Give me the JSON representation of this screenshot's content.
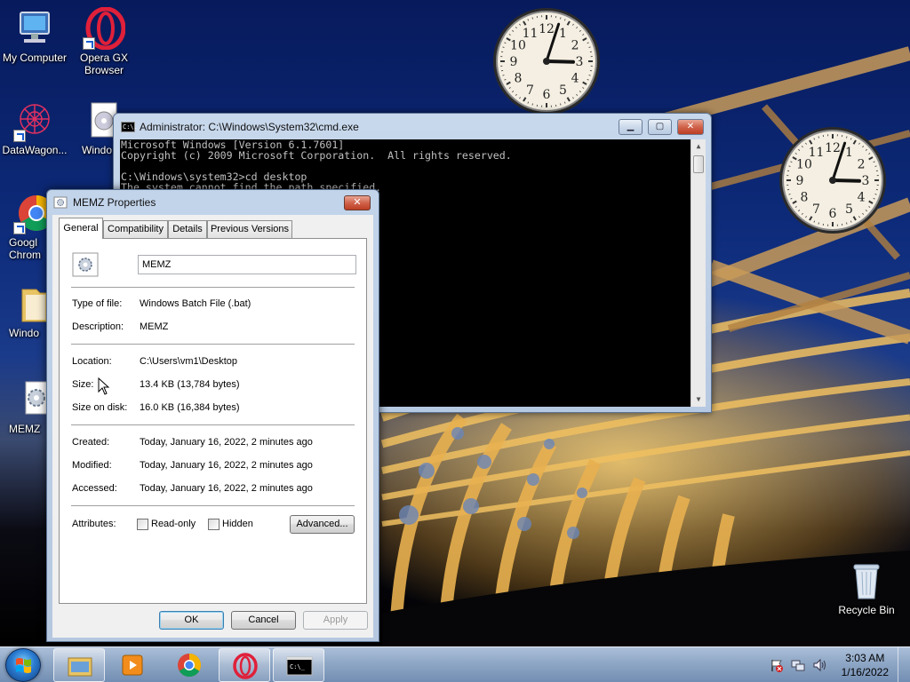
{
  "desktop": {
    "icons": [
      {
        "label": "My Computer"
      },
      {
        "label": "Opera GX Browser"
      },
      {
        "label": "DataWagon..."
      },
      {
        "label": "Windo"
      },
      {
        "label": "Googl Chrom"
      },
      {
        "label": "Windo"
      },
      {
        "label": "MEMZ"
      },
      {
        "label": "Recycle Bin"
      }
    ]
  },
  "clocks": [
    {
      "hour": 3,
      "minute": 3,
      "numerals": [
        "12",
        "1",
        "2",
        "3",
        "4",
        "5",
        "6",
        "7",
        "8",
        "9",
        "10",
        "11"
      ]
    },
    {
      "hour": 3,
      "minute": 3,
      "numerals": [
        "12",
        "1",
        "2",
        "3",
        "4",
        "5",
        "6",
        "7",
        "8",
        "9",
        "10",
        "11"
      ]
    }
  ],
  "cmd": {
    "title": "Administrator: C:\\Windows\\System32\\cmd.exe",
    "title_icon_text": "C:\\.",
    "lines": [
      "Microsoft Windows [Version 6.1.7601]",
      "Copyright (c) 2009 Microsoft Corporation.  All rights reserved.",
      "",
      "C:\\Windows\\system32>cd desktop",
      "The system cannot find the path specified."
    ],
    "minimize_label": "▁",
    "maximize_label": "▢",
    "close_label": "✕",
    "scroll_up": "▲",
    "scroll_down": "▼"
  },
  "props": {
    "title": "MEMZ Properties",
    "close_label": "✕",
    "tabs": [
      "General",
      "Compatibility",
      "Details",
      "Previous Versions"
    ],
    "active_tab": "General",
    "file_name": "MEMZ",
    "rows": [
      {
        "label": "Type of file:",
        "value": "Windows Batch File (.bat)"
      },
      {
        "label": "Description:",
        "value": "MEMZ"
      },
      {
        "label": "Location:",
        "value": "C:\\Users\\vm1\\Desktop"
      },
      {
        "label": "Size:",
        "value": "13.4 KB (13,784 bytes)"
      },
      {
        "label": "Size on disk:",
        "value": "16.0 KB (16,384 bytes)"
      },
      {
        "label": "Created:",
        "value": "Today, January 16, 2022, 2 minutes ago"
      },
      {
        "label": "Modified:",
        "value": "Today, January 16, 2022, 2 minutes ago"
      },
      {
        "label": "Accessed:",
        "value": "Today, January 16, 2022, 2 minutes ago"
      }
    ],
    "attributes_label": "Attributes:",
    "readonly_label": "Read-only",
    "readonly_checked": false,
    "hidden_label": "Hidden",
    "hidden_checked": false,
    "advanced_label": "Advanced...",
    "ok_label": "OK",
    "cancel_label": "Cancel",
    "apply_label": "Apply"
  },
  "taskbar": {
    "time": "3:03 AM",
    "date": "1/16/2022",
    "apps": [
      "Windows Explorer",
      "Media Player",
      "Google Chrome",
      "Opera GX",
      "Command Prompt"
    ]
  }
}
